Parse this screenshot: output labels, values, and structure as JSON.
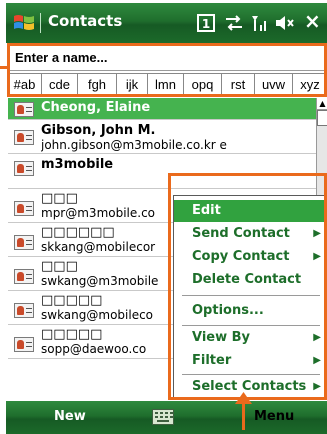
{
  "title_bar": {
    "app_title": "Contacts",
    "status_icons": [
      "sim-card-icon",
      "sync-arrows-icon",
      "signal-icon",
      "volume-icon",
      "close-icon"
    ],
    "close_label": "×"
  },
  "search": {
    "placeholder": "Enter a name..."
  },
  "letter_tabs": [
    "#ab",
    "cde",
    "fgh",
    "ijk",
    "lmn",
    "opq",
    "rst",
    "uvw",
    "xyz"
  ],
  "contacts": [
    {
      "name": "Cheong, Elaine",
      "detail": ""
    },
    {
      "name": "Gibson, John M.",
      "detail": "john.gibson@m3mobile.co.kr    e"
    },
    {
      "name": "m3mobile",
      "detail": ""
    },
    {
      "name": "□□□",
      "detail": "mpr@m3mobile.co"
    },
    {
      "name": "□□□□□□",
      "detail": "skkang@mobilecor"
    },
    {
      "name": "□□□",
      "detail": "swkang@m3mobile"
    },
    {
      "name": "□□□□□",
      "detail": "swkang@mobileco"
    },
    {
      "name": "□□□□□",
      "detail": "sopp@daewoo.co"
    }
  ],
  "context_menu": {
    "items": [
      {
        "label": "Edit",
        "submenu": false
      },
      {
        "label": "Send Contact",
        "submenu": true
      },
      {
        "label": "Copy Contact",
        "submenu": true
      },
      {
        "label": "Delete Contact",
        "submenu": false
      },
      {
        "label": "Options...",
        "submenu": false
      },
      {
        "label": "View By",
        "submenu": true
      },
      {
        "label": "Filter",
        "submenu": true
      },
      {
        "label": "Select Contacts",
        "submenu": true
      }
    ],
    "arrow_glyph": "▶"
  },
  "bottom_bar": {
    "left_softkey": "New",
    "right_softkey": "Menu"
  },
  "colors": {
    "accent_green": "#1f6e2d",
    "selection_green": "#45b34f",
    "menu_text": "#1d6e2a",
    "annotation": "#ea6a1c"
  }
}
